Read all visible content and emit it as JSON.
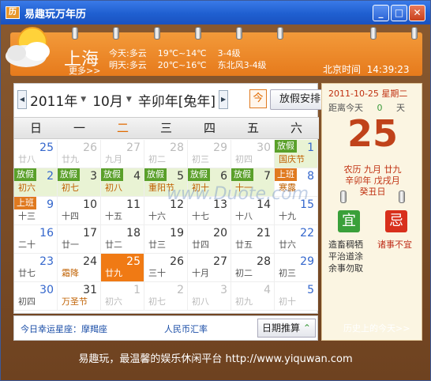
{
  "app": {
    "title": "易趣玩万年历",
    "icon_text": "历"
  },
  "weather": {
    "city": "上海",
    "more": "更多>>",
    "today": "今天:多云    19℃~14℃    3-4级",
    "tomorrow": "明天:多云    20℃~16℃    东北风3-4级",
    "beijing_time": "北京时间  14:39:23"
  },
  "nav": {
    "year": "2011年",
    "month": "10月",
    "ganzhi": "辛卯年[兔年]",
    "today_btn": "今",
    "holiday_btn": "放假安排"
  },
  "weekdays": [
    "日",
    "一",
    "二",
    "三",
    "四",
    "五",
    "六"
  ],
  "cells": [
    {
      "d": "25",
      "lu": "廿八",
      "st": "other"
    },
    {
      "d": "26",
      "lu": "廿九",
      "st": "other"
    },
    {
      "d": "27",
      "lu": "九月",
      "st": "other"
    },
    {
      "d": "28",
      "lu": "初二",
      "st": "other"
    },
    {
      "d": "29",
      "lu": "初三",
      "st": "other"
    },
    {
      "d": "30",
      "lu": "初四",
      "st": "other"
    },
    {
      "d": "1",
      "lu": "国庆节",
      "st": "hol fest",
      "badge": "放假",
      "bt": "off"
    },
    {
      "d": "2",
      "lu": "初六",
      "st": "hol",
      "badge": "放假",
      "bt": "off"
    },
    {
      "d": "3",
      "lu": "初七",
      "st": "hol",
      "badge": "放假",
      "bt": "off"
    },
    {
      "d": "4",
      "lu": "初八",
      "st": "hol",
      "badge": "放假",
      "bt": "off"
    },
    {
      "d": "5",
      "lu": "重阳节",
      "st": "hol",
      "badge": "放假",
      "bt": "off"
    },
    {
      "d": "6",
      "lu": "初十",
      "st": "hol",
      "badge": "放假",
      "bt": "off"
    },
    {
      "d": "7",
      "lu": "十一",
      "st": "hol",
      "badge": "放假",
      "bt": "off"
    },
    {
      "d": "8",
      "lu": "寒露",
      "st": "fest",
      "badge": "上班",
      "bt": "work"
    },
    {
      "d": "9",
      "lu": "十三",
      "st": "",
      "badge": "上班",
      "bt": "work"
    },
    {
      "d": "10",
      "lu": "十四",
      "st": ""
    },
    {
      "d": "11",
      "lu": "十五",
      "st": ""
    },
    {
      "d": "12",
      "lu": "十六",
      "st": ""
    },
    {
      "d": "13",
      "lu": "十七",
      "st": ""
    },
    {
      "d": "14",
      "lu": "十八",
      "st": ""
    },
    {
      "d": "15",
      "lu": "十九",
      "st": ""
    },
    {
      "d": "16",
      "lu": "二十",
      "st": ""
    },
    {
      "d": "17",
      "lu": "廿一",
      "st": ""
    },
    {
      "d": "18",
      "lu": "廿二",
      "st": ""
    },
    {
      "d": "19",
      "lu": "廿三",
      "st": ""
    },
    {
      "d": "20",
      "lu": "廿四",
      "st": ""
    },
    {
      "d": "21",
      "lu": "廿五",
      "st": ""
    },
    {
      "d": "22",
      "lu": "廿六",
      "st": ""
    },
    {
      "d": "23",
      "lu": "廿七",
      "st": ""
    },
    {
      "d": "24",
      "lu": "霜降",
      "st": "fest"
    },
    {
      "d": "25",
      "lu": "廿九",
      "st": "sel"
    },
    {
      "d": "26",
      "lu": "三十",
      "st": ""
    },
    {
      "d": "27",
      "lu": "十月",
      "st": ""
    },
    {
      "d": "28",
      "lu": "初二",
      "st": ""
    },
    {
      "d": "29",
      "lu": "初三",
      "st": ""
    },
    {
      "d": "30",
      "lu": "初四",
      "st": ""
    },
    {
      "d": "31",
      "lu": "万圣节",
      "st": "fest"
    },
    {
      "d": "1",
      "lu": "初六",
      "st": "other"
    },
    {
      "d": "2",
      "lu": "初七",
      "st": "other"
    },
    {
      "d": "3",
      "lu": "初八",
      "st": "other"
    },
    {
      "d": "4",
      "lu": "初九",
      "st": "other"
    },
    {
      "d": "5",
      "lu": "初十",
      "st": "other"
    }
  ],
  "calfoot": {
    "lucky": "今日幸运星座：摩羯座",
    "rate": "人民币汇率",
    "calc_btn": "日期推算"
  },
  "detail": {
    "date": "2011-10-25  星期二",
    "distance": "距离今天   0   天",
    "distance_label": "距离今天",
    "distance_num": "0",
    "distance_unit": "天",
    "day": "25",
    "lunar1": "农历  九月  廿九",
    "lunar2": "辛卯年  戊戌月",
    "lunar3": "癸丑日",
    "yi": "宜",
    "ji": "忌",
    "yi_items": [
      "造畜稠牺",
      "平治道涂",
      "余事勿取"
    ],
    "ji_items": [
      "诸事不宜"
    ]
  },
  "history": "历史上的今天>>",
  "footer": "易趣玩，最温馨的娱乐休闲平台    http://www.yiquwan.com",
  "watermark": "www.Duote.com"
}
